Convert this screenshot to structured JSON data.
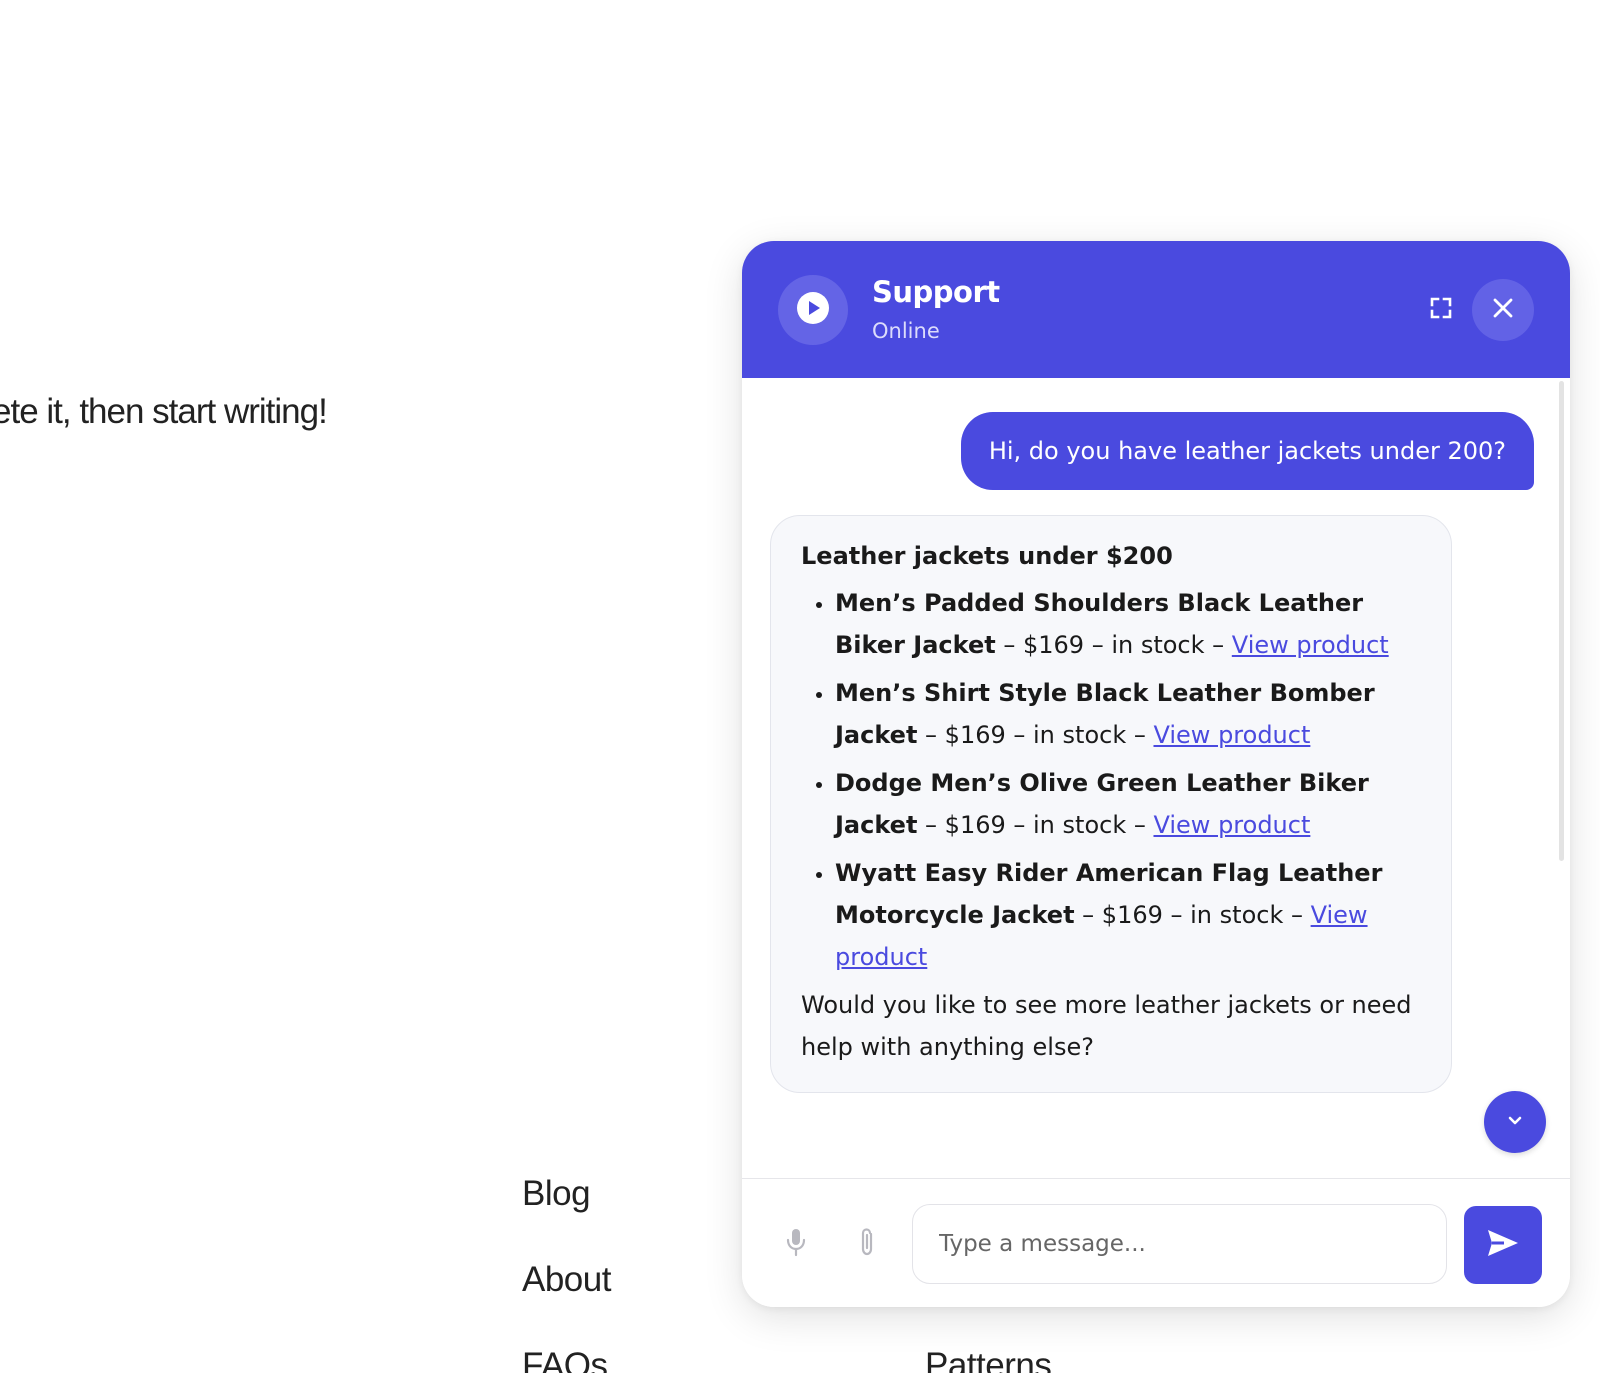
{
  "background": {
    "partial_text": "ete it, then start writing!",
    "footer_links": {
      "blog": "Blog",
      "about": "About",
      "faqs": "FAQs",
      "patterns": "Patterns"
    }
  },
  "chat": {
    "header": {
      "title": "Support",
      "status": "Online",
      "avatar_icon": "play-icon",
      "expand_icon": "expand-icon",
      "close_icon": "close-icon"
    },
    "user_message": "Hi, do you have leather jackets under 200?",
    "bot_message": {
      "heading": "Leather jackets under $200",
      "products": [
        {
          "name": "Men’s Padded Shoulders Black Leather Biker Jacket",
          "details": " – $169 – in stock – ",
          "link": "View product"
        },
        {
          "name": "Men’s Shirt Style Black Leather Bomber Jacket",
          "details": " – $169 – in stock – ",
          "link": "View product"
        },
        {
          "name": "Dodge Men’s Olive Green Leather Biker Jacket",
          "details": " – $169 – in stock – ",
          "link": "View product"
        },
        {
          "name": "Wyatt Easy Rider American Flag Leather Motorcycle Jacket",
          "details": " – $169 – in stock – ",
          "link": "View product"
        }
      ],
      "footer": "Would you like to see more leather jackets or need help with anything else?"
    },
    "composer": {
      "placeholder": "Type a message...",
      "mic_icon": "microphone-icon",
      "attach_icon": "paperclip-icon",
      "send_icon": "send-icon"
    },
    "colors": {
      "accent": "#4a4adf",
      "bubble_bg": "#f7f8fb"
    }
  }
}
